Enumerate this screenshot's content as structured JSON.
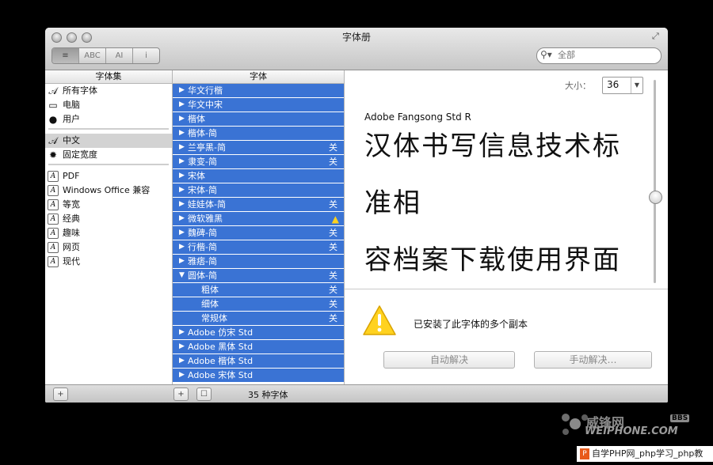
{
  "window": {
    "title": "字体册",
    "search_placeholder": "全部"
  },
  "toolbar": {
    "view_buttons": [
      {
        "label": "≡",
        "icon": "list-view-icon"
      },
      {
        "label": "ABC",
        "icon": "sample-view-icon"
      },
      {
        "label": "AI",
        "icon": "repertoire-view-icon"
      },
      {
        "label": "i",
        "icon": "info-view-icon"
      }
    ]
  },
  "collections": {
    "header": "字体集",
    "items": [
      {
        "label": "所有字体",
        "icon": "font-script-icon",
        "selected": false
      },
      {
        "label": "电脑",
        "icon": "computer-icon",
        "selected": false
      },
      {
        "label": "用户",
        "icon": "user-icon",
        "selected": false
      },
      {
        "label": "中文",
        "icon": "font-script-icon",
        "selected": true
      },
      {
        "label": "固定宽度",
        "icon": "gear-icon",
        "selected": false
      },
      {
        "label": "PDF",
        "icon": "collection-icon",
        "selected": false
      },
      {
        "label": "Windows Office 兼容",
        "icon": "collection-icon",
        "selected": false
      },
      {
        "label": "等宽",
        "icon": "collection-icon",
        "selected": false
      },
      {
        "label": "经典",
        "icon": "collection-icon",
        "selected": false
      },
      {
        "label": "趣味",
        "icon": "collection-icon",
        "selected": false
      },
      {
        "label": "网页",
        "icon": "collection-icon",
        "selected": false
      },
      {
        "label": "现代",
        "icon": "collection-icon",
        "selected": false
      }
    ]
  },
  "fonts": {
    "header": "字体",
    "off_label": "关",
    "rows": [
      {
        "name": "华文行楷",
        "arrow": "▶",
        "off": false
      },
      {
        "name": "华文中宋",
        "arrow": "▶",
        "off": false
      },
      {
        "name": "楷体",
        "arrow": "▶",
        "off": false
      },
      {
        "name": "楷体-简",
        "arrow": "▶",
        "off": false
      },
      {
        "name": "兰亭黑-简",
        "arrow": "▶",
        "off": true
      },
      {
        "name": "隶变-简",
        "arrow": "▶",
        "off": true
      },
      {
        "name": "宋体",
        "arrow": "▶",
        "off": false
      },
      {
        "name": "宋体-简",
        "arrow": "▶",
        "off": false
      },
      {
        "name": "娃娃体-简",
        "arrow": "▶",
        "off": true
      },
      {
        "name": "微软雅黑",
        "arrow": "▶",
        "off": false,
        "warning": true
      },
      {
        "name": "魏碑-简",
        "arrow": "▶",
        "off": true
      },
      {
        "name": "行楷-简",
        "arrow": "▶",
        "off": true
      },
      {
        "name": "雅痞-简",
        "arrow": "▶",
        "off": false
      },
      {
        "name": "圆体-简",
        "arrow": "▼",
        "off": true
      },
      {
        "name": "粗体",
        "arrow": "",
        "off": true,
        "sub": true
      },
      {
        "name": "细体",
        "arrow": "",
        "off": true,
        "sub": true
      },
      {
        "name": "常规体",
        "arrow": "",
        "off": true,
        "sub": true
      },
      {
        "name": "Adobe 仿宋 Std",
        "arrow": "▶",
        "off": false
      },
      {
        "name": "Adobe 黑体 Std",
        "arrow": "▶",
        "off": false
      },
      {
        "name": "Adobe 楷体 Std",
        "arrow": "▶",
        "off": false
      },
      {
        "name": "Adobe 宋体 Std",
        "arrow": "▶",
        "off": false
      }
    ],
    "count_label": "35 种字体"
  },
  "preview": {
    "size_label": "大小：",
    "size_value": "36",
    "font_name": "Adobe Fangsong Std R",
    "sample_lines": [
      "汉体书写信息技术标",
      "准相",
      "容档案下载使用界面"
    ],
    "warning_message": "已安装了此字体的多个副本",
    "auto_resolve_label": "自动解决",
    "manual_resolve_label": "手动解决…"
  },
  "watermark": {
    "site_cn": "威锋网",
    "bbs": "BBS",
    "site_url": "WEIPHONE.COM",
    "footer_text": "自学PHP网_php学习_php教"
  },
  "colors": {
    "selection_blue": "#3a73d4",
    "warning_yellow": "#ffd21f"
  }
}
